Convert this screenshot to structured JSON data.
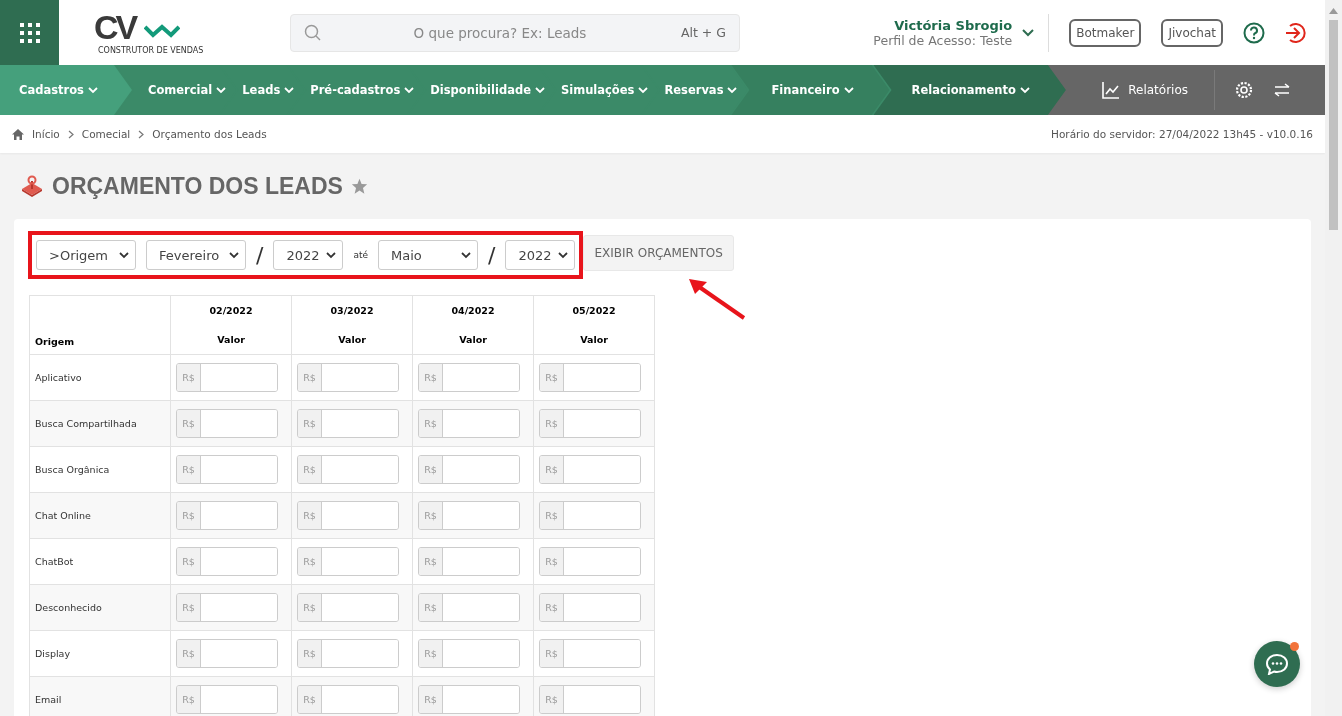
{
  "header": {
    "logo_text": "CV",
    "logo_subtitle": "CONSTRUTOR DE VENDAS",
    "search": {
      "placeholder": "O que procura? Ex: Leads",
      "shortcut": "Alt + G"
    },
    "user": {
      "name": "Victória Sbrogio",
      "profile": "Perfil de Acesso: Teste"
    },
    "buttons": [
      "Botmaker",
      "Jivochat"
    ]
  },
  "nav": {
    "items": [
      {
        "label": "Cadastros",
        "kind": "light"
      },
      {
        "label": "Comercial",
        "kind": "medium"
      },
      {
        "label": "Leads",
        "kind": "medium"
      },
      {
        "label": "Pré-cadastros",
        "kind": "medium"
      },
      {
        "label": "Disponibilidade",
        "kind": "medium"
      },
      {
        "label": "Simulações",
        "kind": "medium"
      },
      {
        "label": "Reservas",
        "kind": "medium"
      },
      {
        "label": "Financeiro",
        "kind": "dark"
      },
      {
        "label": "Relacionamento",
        "kind": "darkest"
      }
    ],
    "reports": "Relatórios"
  },
  "breadcrumb": [
    "Início",
    "Comecial",
    "Orçamento dos Leads"
  ],
  "server_time": "Horário do servidor: 27/04/2022 13h45 - v10.0.16",
  "page_title": "ORÇAMENTO DOS LEADS",
  "filters": {
    "group": ">Origem",
    "from_month": "Fevereiro",
    "from_year": "2022",
    "separator": "/",
    "until": "até",
    "to_month": "Maio",
    "to_year": "2022",
    "button": "EXIBIR ORÇAMENTOS"
  },
  "table": {
    "first_column": "Origem",
    "periods": [
      {
        "period": "02/2022",
        "label": "Valor"
      },
      {
        "period": "03/2022",
        "label": "Valor"
      },
      {
        "period": "04/2022",
        "label": "Valor"
      },
      {
        "period": "05/2022",
        "label": "Valor"
      }
    ],
    "rows": [
      {
        "origem": "Aplicativo",
        "prefixes": [
          "R$",
          "R$",
          "R$",
          "R$"
        ]
      },
      {
        "origem": "Busca Compartilhada",
        "prefixes": [
          "R$",
          "R$",
          "R$",
          "R$"
        ]
      },
      {
        "origem": "Busca Orgânica",
        "prefixes": [
          "R$",
          "R$",
          "R$",
          "R$"
        ]
      },
      {
        "origem": "Chat Online",
        "prefixes": [
          "R$",
          "R$",
          "R$",
          "R$"
        ]
      },
      {
        "origem": "ChatBot",
        "prefixes": [
          "R$",
          "R$",
          "R$",
          "R$"
        ]
      },
      {
        "origem": "Desconhecido",
        "prefixes": [
          "R$",
          "R$",
          "R$",
          "R$"
        ]
      },
      {
        "origem": "Display",
        "prefixes": [
          "R$",
          "R$",
          "R$",
          "R$"
        ]
      },
      {
        "origem": "Email",
        "prefixes": [
          "R$",
          "R$",
          "R$",
          "R$"
        ]
      }
    ]
  },
  "chat": {
    "has_notification": true
  }
}
